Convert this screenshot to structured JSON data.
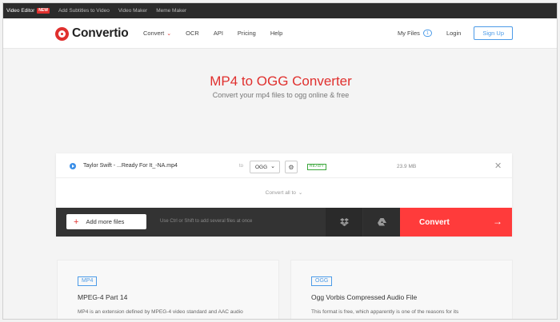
{
  "topbar": {
    "links": [
      {
        "label": "Video Editor",
        "badge": "NEW"
      },
      {
        "label": "Add Subtitles to Video"
      },
      {
        "label": "Video Maker"
      },
      {
        "label": "Meme Maker"
      }
    ]
  },
  "header": {
    "brand": "Convertio",
    "nav": [
      "Convert",
      "OCR",
      "API",
      "Pricing",
      "Help"
    ],
    "my_files_label": "My Files",
    "my_files_count": "1",
    "login_label": "Login",
    "signup_label": "Sign Up"
  },
  "hero": {
    "title": "MP4 to OGG Converter",
    "subtitle": "Convert your mp4 files to ogg online & free"
  },
  "file": {
    "name": "Taylor Swift - ...Ready For It_-NA.mp4",
    "to_label": "to",
    "target_format": "OGG",
    "status": "READY",
    "size": "23.9 MB"
  },
  "converter": {
    "convert_all_label": "Convert all to",
    "add_files_label": "Add more files",
    "hint": "Use Ctrl or Shift to add several files at once",
    "convert_label": "Convert"
  },
  "cards": [
    {
      "tag": "MP4",
      "title": "MPEG-4 Part 14",
      "desc": "MP4 is an extension defined by MPEG-4 video standard and AAC audio"
    },
    {
      "tag": "OGG",
      "title": "Ogg Vorbis Compressed Audio File",
      "desc": "This format is free, which apparently is one of the reasons for its"
    }
  ],
  "colors": {
    "brand_red": "#e0302e",
    "convert_red": "#ff3b3b",
    "link_blue": "#4c9be8",
    "ready_green": "#3aa63a"
  }
}
